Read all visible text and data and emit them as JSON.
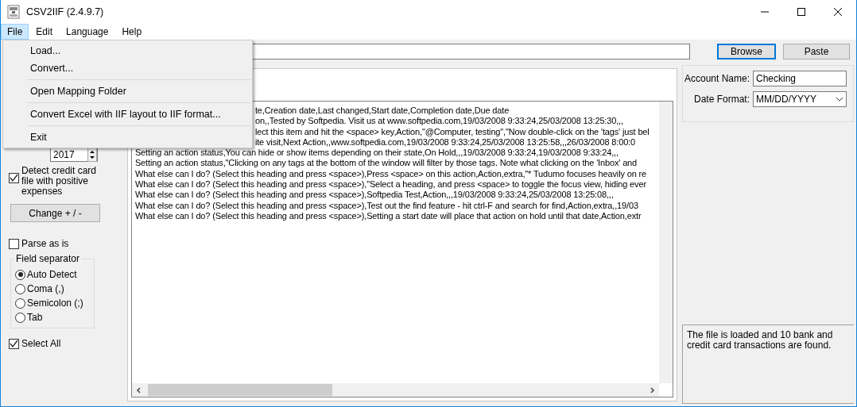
{
  "window": {
    "title": "CSV2IIF (2.4.9.7)"
  },
  "menu_bar": [
    {
      "label": "File",
      "selected": true
    },
    {
      "label": "Edit",
      "selected": false
    },
    {
      "label": "Language",
      "selected": false
    },
    {
      "label": "Help",
      "selected": false
    }
  ],
  "file_menu": [
    {
      "kind": "item",
      "label": "Load..."
    },
    {
      "kind": "item",
      "label": "Convert..."
    },
    {
      "kind": "separator"
    },
    {
      "kind": "item",
      "label": "Open Mapping Folder"
    },
    {
      "kind": "separator"
    },
    {
      "kind": "item",
      "label": "Convert Excel with IIF layout to IIF format..."
    },
    {
      "kind": "separator"
    },
    {
      "kind": "item",
      "label": "Exit"
    }
  ],
  "toolbar": {
    "browse": "Browse",
    "paste": "Paste"
  },
  "left_panel": {
    "year": "2017",
    "detect_credit_card": {
      "label": "Detect credit card file with positive expenses",
      "checked": true
    },
    "change_button": "Change + / -",
    "parse_as_is": {
      "label": "Parse as is",
      "checked": false
    },
    "field_separator": {
      "title": "Field separator",
      "options": [
        {
          "label": "Auto Detect",
          "selected": true
        },
        {
          "label": "Coma (,)",
          "selected": false
        },
        {
          "label": "Semicolon (;)",
          "selected": false
        },
        {
          "label": "Tab",
          "selected": false
        }
      ]
    },
    "select_all": {
      "label": "Select All",
      "checked": true
    }
  },
  "preview": {
    "lines": [
      {
        "text": "te,Creation date,Last changed,Start date,Completion date,Due date",
        "covered": true
      },
      {
        "text": "on,,Tested by Softpedia. Visit us at www.softpedia.com,19/03/2008 9:33:24,25/03/2008 13:25:30,,,",
        "covered": true
      },
      {
        "text": "lect this item and hit the <space> key,Action,\"@Computer, testing\",\"Now double-click on the 'tags' just bel",
        "covered": true
      },
      {
        "text": "ite visit,Next Action,,www.softpedia.com,19/03/2008 9:33:24,25/03/2008 13:25:58,,,26/03/2008 8:00:0",
        "covered": true
      },
      {
        "text": "Setting an action status,You can hide or show items depending on their state,On Hold,,,19/03/2008 9:33:24,19/03/2008 9:33:24,,,",
        "covered": false
      },
      {
        "text": "Setting an action status,\"Clicking on any tags at the bottom of the window will filter by those tags.  Note what clicking on the 'Inbox' and",
        "covered": false
      },
      {
        "text": "What else can I do? (Select this heading and press <space>),Press <space> on this action,Action,extra,\"* Tudumo focuses heavily on re",
        "covered": false
      },
      {
        "text": "What else can I do? (Select this heading and press <space>),\"Select a heading, and press <space> to toggle the focus view, hiding ever",
        "covered": false
      },
      {
        "text": "What else can I do? (Select this heading and press <space>),Softpedia Test,Action,,,19/03/2008 9:33:24,25/03/2008 13:25:08,,,",
        "covered": false
      },
      {
        "text": "What else can I do? (Select this heading and press <space>),Test out the find feature - hit ctrl-F and search for find,Action,extra,,19/03",
        "covered": false
      },
      {
        "text": "What else can I do? (Select this heading and press <space>),Setting a start date will place that action on hold until that date,Action,extr",
        "covered": false
      }
    ]
  },
  "account": {
    "account_name_label": "Account Name:",
    "account_name": "Checking",
    "date_format_label": "Date Format:",
    "date_format": "MM/DD/YYYY"
  },
  "status_message": "The file is loaded and 10 bank and credit card transactions are found."
}
